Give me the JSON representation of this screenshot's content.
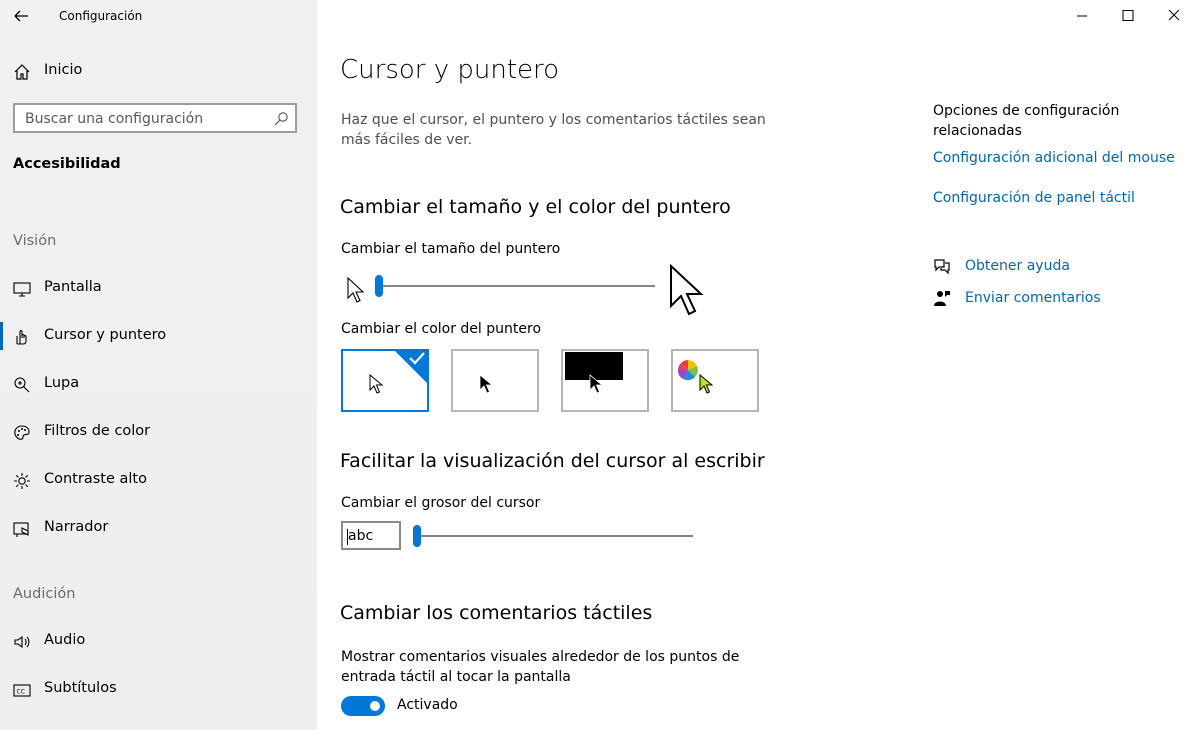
{
  "window": {
    "title": "Configuración",
    "controls": [
      "minimize-icon",
      "maximize-icon",
      "close-icon"
    ]
  },
  "sidebar": {
    "home": "Inicio",
    "search_placeholder": "Buscar una configuración",
    "category": "Accesibilidad",
    "sections": [
      {
        "title": "Visión",
        "items": [
          {
            "label": "Pantalla",
            "icon": "monitor-icon"
          },
          {
            "label": "Cursor y puntero",
            "icon": "cursor-hand-icon",
            "active": true
          },
          {
            "label": "Lupa",
            "icon": "magnifier-icon"
          },
          {
            "label": "Filtros de color",
            "icon": "palette-icon"
          },
          {
            "label": "Contraste alto",
            "icon": "brightness-icon"
          },
          {
            "label": "Narrador",
            "icon": "narrator-icon"
          }
        ]
      },
      {
        "title": "Audición",
        "items": [
          {
            "label": "Audio",
            "icon": "speaker-icon"
          },
          {
            "label": "Subtítulos",
            "icon": "captions-icon"
          }
        ]
      }
    ]
  },
  "main": {
    "title": "Cursor y puntero",
    "description": "Haz que el cursor, el puntero y los comentarios táctiles sean más fáciles de ver.",
    "pointer_section": {
      "heading": "Cambiar el tamaño y el color del puntero",
      "size_label": "Cambiar el tamaño del puntero",
      "size_value_fraction": 0.0,
      "color_label": "Cambiar el color del puntero",
      "color_options": [
        "white",
        "black",
        "inverted",
        "custom"
      ],
      "selected_color": "white"
    },
    "cursor_section": {
      "heading": "Facilitar la visualización del cursor al escribir",
      "thickness_label": "Cambiar el grosor del cursor",
      "preview_text": "abc",
      "thickness_value_fraction": 0.0
    },
    "touch_section": {
      "heading": "Cambiar los comentarios táctiles",
      "toggle_label": "Mostrar comentarios visuales alrededor de los puntos de entrada táctil al tocar la pantalla",
      "toggle_state": "Activado",
      "toggle_on": true
    }
  },
  "related": {
    "title": "Opciones de configuración relacionadas",
    "links": [
      "Configuración adicional del mouse",
      "Configuración de panel táctil"
    ],
    "help": "Obtener ayuda",
    "feedback": "Enviar comentarios"
  },
  "colors": {
    "accent": "#0078d7",
    "link": "#0067b8"
  }
}
